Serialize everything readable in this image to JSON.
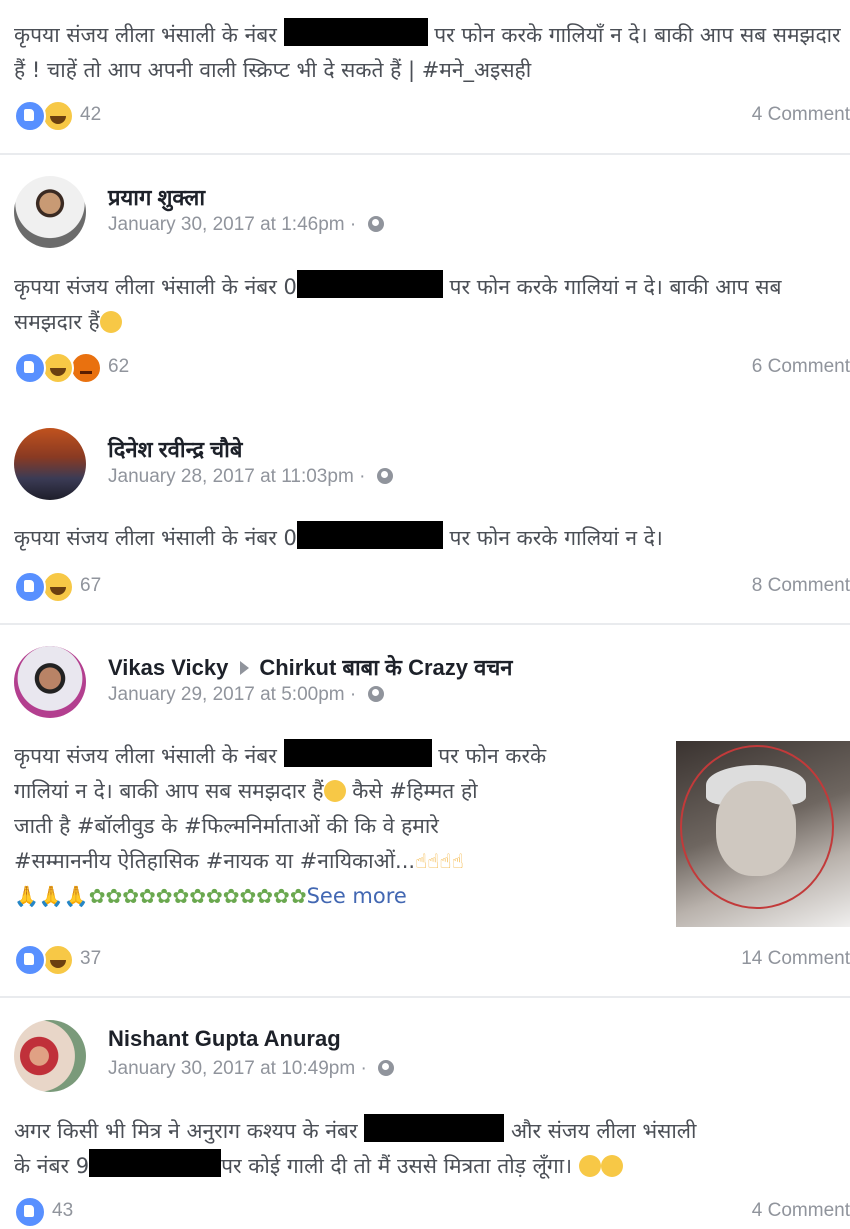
{
  "posts": [
    {
      "text_before": "कृपया संजय लीला भंसाली के नंबर",
      "text_after": "पर फोन करके गालियाँ न दे। बाकी आप सब समझदार हैं ! चाहें तो आप अपनी वाली स्क्रिप्ट भी दे सकते हैं | #मने_अइसही",
      "reaction_count": "42",
      "comments": "4 Comment"
    },
    {
      "author": "प्रयाग शुक्ला",
      "timestamp": "January 30, 2017 at 1:46pm",
      "text_before": "कृपया संजय लीला भंसाली के नंबर 0",
      "text_after": "पर फोन करके गालियां न दे। बाकी आप सब समझदार हैं",
      "reaction_count": "62",
      "comments": "6 Comment"
    },
    {
      "author": "दिनेश रवीन्द्र चौबे",
      "timestamp": "January 28, 2017 at 11:03pm",
      "text_before": "कृपया संजय लीला भंसाली के नंबर 0",
      "text_after": "पर फोन करके गालियां न दे।",
      "reaction_count": "67",
      "comments": "8 Comment"
    },
    {
      "author": "Vikas Vicky",
      "page": "Chirkut बाबा के Crazy वचन",
      "timestamp": "January 29, 2017 at 5:00pm",
      "text_before": "कृपया संजय लीला भंसाली के नंबर",
      "text_after": "पर फोन करके",
      "line2": "गालियां न दे। बाकी आप सब समझदार हैं",
      "line2b": "कैसे #हिम्मत हो",
      "line3": "जाती है #बॉलीवुड के #फिल्मनिर्माताओं की कि वे हमारे",
      "line4": "#सम्माननीय ऐतिहासिक #नायक या #नायिकाओं...",
      "see_more": "See more",
      "reaction_count": "37",
      "comments": "14 Comment"
    },
    {
      "author": "Nishant Gupta Anurag",
      "timestamp": "January 30, 2017 at 10:49pm",
      "text_before": "अगर किसी भी मित्र ने अनुराग कश्यप के नंबर",
      "text_mid": "और संजय लीला भंसाली",
      "line2_before": "के नंबर 9",
      "line2_after": "पर कोई गाली दी तो मैं उससे मित्रता तोड़ लूँगा।",
      "reaction_count": "43",
      "comments": "4 Comment"
    }
  ],
  "icons": {
    "like": "like-icon",
    "haha": "haha-icon",
    "angry": "angry-icon",
    "globe": "globe-icon"
  },
  "colors": {
    "like_blue": "#5890ff",
    "link_blue": "#4267b2",
    "meta_gray": "#90949c"
  }
}
